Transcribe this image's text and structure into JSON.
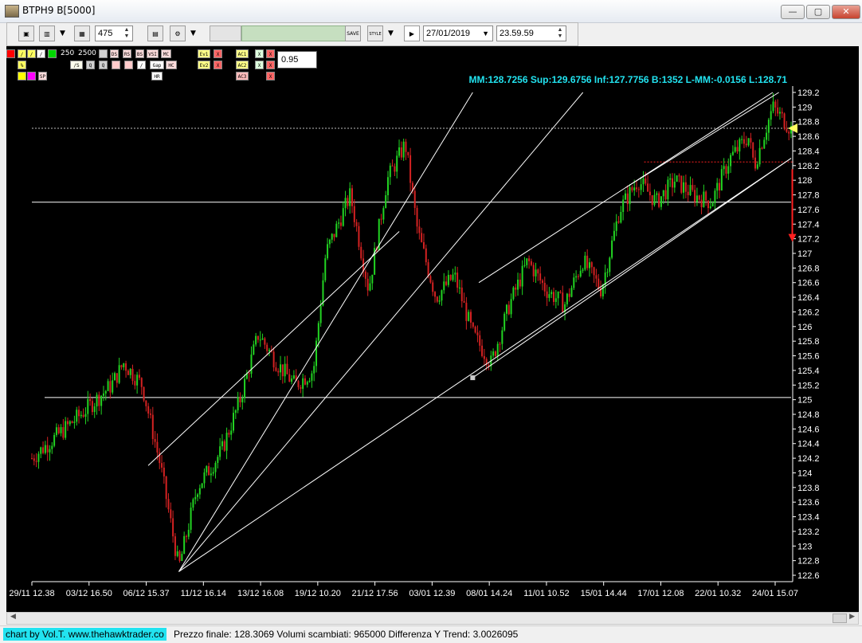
{
  "window": {
    "title": "BTPH9 B[5000]",
    "min_label": "—",
    "max_label": "▢",
    "close_label": "✕"
  },
  "toolbar": {
    "bars_value": "475",
    "save_label": "SAVE",
    "style_label": "STYLE",
    "date_value": "27/01/2019",
    "time_value": "23.59.59"
  },
  "indicators": {
    "counts": [
      "250",
      "2500"
    ],
    "value": "0.95",
    "buttons_row1": [
      "/",
      "/",
      "/",
      "",
      "",
      "DS",
      "RS",
      "BS",
      "VSI",
      "MC",
      "Ev1",
      "X",
      "AC1",
      "X",
      "X"
    ],
    "buttons_row2": [
      "%",
      "/S",
      "Q",
      "Q",
      "",
      "",
      "/",
      "Gap",
      "HC",
      "Ev2",
      "X",
      "AC2",
      "X",
      "X"
    ],
    "buttons_row3": [
      "",
      "",
      "SP",
      "HR",
      "AC3",
      "X"
    ]
  },
  "chart_data": {
    "type": "candlestick",
    "header": "MM:128.7256 Sup:129.6756 Inf:127.7756 B:1352 L-MM:-0.0156 L:128.71",
    "ylim": [
      122.6,
      129.2
    ],
    "y_ticks": [
      "129.2",
      "129",
      "128.8",
      "128.6",
      "128.4",
      "128.2",
      "128",
      "127.8",
      "127.6",
      "127.4",
      "127.2",
      "127",
      "126.8",
      "126.6",
      "126.4",
      "126.2",
      "126",
      "125.8",
      "125.6",
      "125.4",
      "125.2",
      "125",
      "124.8",
      "124.6",
      "124.4",
      "124.2",
      "124",
      "123.8",
      "123.6",
      "123.4",
      "123.2",
      "123",
      "122.8",
      "122.6"
    ],
    "x_ticks": [
      "29/11 12.38",
      "03/12 16.50",
      "06/12 15.37",
      "11/12 16.14",
      "13/12 16.08",
      "19/12 10.20",
      "21/12 17.56",
      "03/01 12.39",
      "08/01 14.24",
      "11/01 10.52",
      "15/01 14.44",
      "17/01 12.08",
      "22/01 10.32",
      "24/01 15.07"
    ],
    "series_points": [
      [
        0,
        124.2
      ],
      [
        8,
        124.8
      ],
      [
        13,
        125.2
      ],
      [
        15,
        125.5
      ],
      [
        18,
        125.2
      ],
      [
        21,
        124.1
      ],
      [
        24,
        122.7
      ],
      [
        27,
        123.8
      ],
      [
        31,
        124.3
      ],
      [
        34,
        125.0
      ],
      [
        37,
        125.9
      ],
      [
        40,
        125.5
      ],
      [
        43,
        125.2
      ],
      [
        46,
        125.4
      ],
      [
        48,
        127.0
      ],
      [
        52,
        127.8
      ],
      [
        55,
        126.5
      ],
      [
        58,
        128.0
      ],
      [
        61,
        128.5
      ],
      [
        63,
        127.3
      ],
      [
        66,
        126.4
      ],
      [
        69,
        126.7
      ],
      [
        72,
        125.9
      ],
      [
        75,
        125.5
      ],
      [
        78,
        126.3
      ],
      [
        81,
        126.9
      ],
      [
        84,
        126.5
      ],
      [
        87,
        126.3
      ],
      [
        90,
        126.9
      ],
      [
        93,
        126.5
      ],
      [
        96,
        127.6
      ],
      [
        99,
        128.0
      ],
      [
        102,
        127.7
      ],
      [
        105,
        128.0
      ],
      [
        108,
        127.8
      ],
      [
        111,
        127.7
      ],
      [
        114,
        128.3
      ],
      [
        117,
        128.6
      ],
      [
        118,
        128.2
      ],
      [
        121,
        129.0
      ],
      [
        124,
        128.7
      ]
    ],
    "horizontal_levels": [
      {
        "value": 128.71,
        "style": "dotted",
        "color": "#bbbbbb"
      },
      {
        "value": 127.7,
        "style": "solid",
        "color": "#ffffff"
      },
      {
        "value": 125.03,
        "style": "solid",
        "color": "#ffffff"
      },
      {
        "value": 128.25,
        "style": "dotted",
        "color": "#ff2020"
      }
    ],
    "trend_lines": [
      [
        [
          24,
          122.65
        ],
        [
          72,
          129.2
        ]
      ],
      [
        [
          24,
          122.65
        ],
        [
          90,
          129.2
        ]
      ],
      [
        [
          24,
          122.65
        ],
        [
          124,
          128.3
        ]
      ],
      [
        [
          19,
          124.1
        ],
        [
          60,
          127.3
        ]
      ],
      [
        [
          72,
          125.3
        ],
        [
          124,
          128.3
        ]
      ],
      [
        [
          73,
          126.6
        ],
        [
          121,
          129.2
        ]
      ],
      [
        [
          97,
          127.9
        ],
        [
          122,
          129.2
        ]
      ]
    ],
    "grid": false,
    "bullish_color": "#22d422",
    "bearish_color": "#d42222"
  },
  "status": {
    "credit": "chart by Vol.T. www.thehawktrader.co",
    "text": "Prezzo finale: 128.3069 Volumi scambiati: 965000 Differenza Y Trend: 3.0026095"
  }
}
